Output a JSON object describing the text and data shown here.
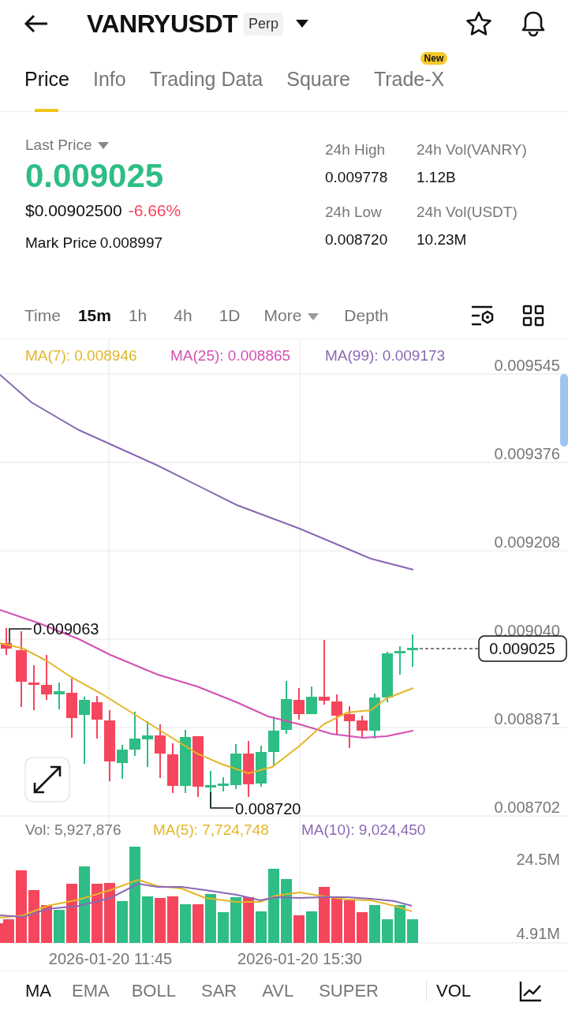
{
  "header": {
    "title": "VANRYUSDT",
    "badge": "Perp"
  },
  "tabs": [
    {
      "label": "Price",
      "selected": true
    },
    {
      "label": "Info",
      "selected": false
    },
    {
      "label": "Trading Data",
      "selected": false
    },
    {
      "label": "Square",
      "selected": false
    },
    {
      "label": "Trade-X",
      "selected": false,
      "badge": "New"
    }
  ],
  "ticker": {
    "last_price_label": "Last Price",
    "last_price": "0.009025",
    "usd_price": "$0.00902500",
    "change": "-6.66%",
    "mark_price_label": "Mark Price",
    "mark_price": "0.008997",
    "stats": [
      {
        "label": "24h High",
        "value": "0.009778"
      },
      {
        "label": "24h Vol(VANRY)",
        "value": "1.12B"
      },
      {
        "label": "24h Low",
        "value": "0.008720"
      },
      {
        "label": "24h Vol(USDT)",
        "value": "10.23M"
      }
    ]
  },
  "intervals": [
    {
      "label": "Time",
      "kind": "option",
      "selected": false
    },
    {
      "label": "15m",
      "kind": "option",
      "selected": true
    },
    {
      "label": "1h",
      "kind": "option",
      "selected": false
    },
    {
      "label": "4h",
      "kind": "option",
      "selected": false
    },
    {
      "label": "1D",
      "kind": "option",
      "selected": false
    },
    {
      "label": "More",
      "kind": "dropdown",
      "selected": false
    },
    {
      "label": "Depth",
      "kind": "option",
      "selected": false
    }
  ],
  "price_chart": {
    "legend": [
      {
        "label": "MA(7): 0.008946",
        "color": "#e3b626"
      },
      {
        "label": "MA(25): 0.008865",
        "color": "#d44fb4"
      },
      {
        "label": "MA(99): 0.009173",
        "color": "#8a68b5"
      }
    ],
    "y_axis": [
      "0.009545",
      "0.009376",
      "0.009208",
      "0.009040",
      "0.008871",
      "0.008702"
    ],
    "current_price": "0.009025",
    "high_label": "0.009063",
    "low_label": "0.008720"
  },
  "volume_chart": {
    "legend": [
      {
        "label": "Vol: 5,927,876",
        "color": "#777777"
      },
      {
        "label": "MA(5): 7,724,748",
        "color": "#e3b626"
      },
      {
        "label": "MA(10): 9,024,450",
        "color": "#8a68b5"
      }
    ],
    "y_axis": [
      "24.5M",
      "4.91M"
    ]
  },
  "time_axis": [
    "2026-01-20 11:45",
    "2026-01-20 15:30"
  ],
  "indicators": {
    "main": [
      {
        "label": "MA",
        "selected": true
      },
      {
        "label": "EMA",
        "selected": false
      },
      {
        "label": "BOLL",
        "selected": false
      },
      {
        "label": "SAR",
        "selected": false
      },
      {
        "label": "AVL",
        "selected": false
      },
      {
        "label": "SUPER",
        "selected": false
      }
    ],
    "sub": [
      {
        "label": "VOL",
        "selected": true
      }
    ]
  }
}
